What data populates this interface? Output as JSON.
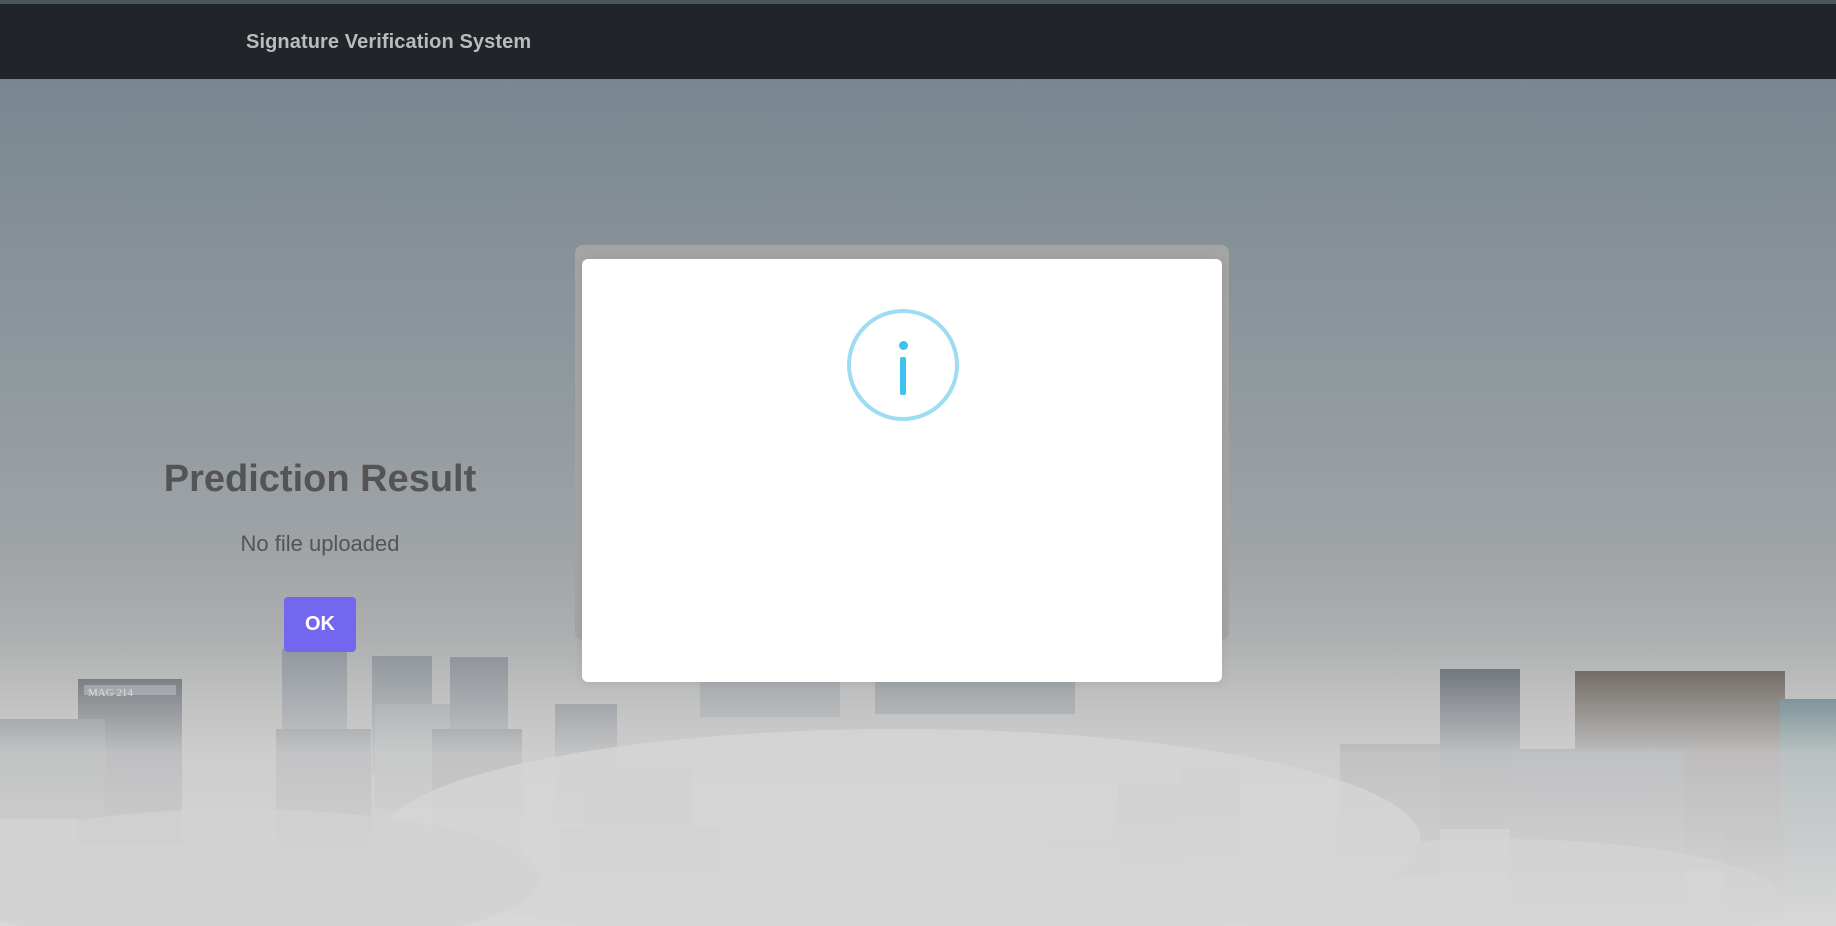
{
  "navbar": {
    "brand": "Signature Verification System"
  },
  "dialog": {
    "icon": "info-icon",
    "title": "Prediction Result",
    "message": "No file uploaded",
    "ok_label": "OK",
    "icon_color": "#3fc3ee",
    "button_color": "#7367f0"
  },
  "background": {
    "image": "city-skyline-above-fog",
    "building_sign": "MAG 214"
  }
}
